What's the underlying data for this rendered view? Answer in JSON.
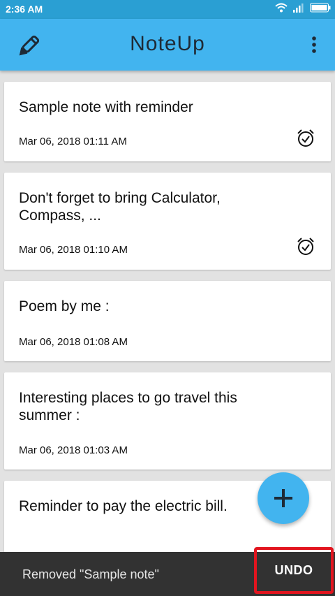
{
  "status_bar": {
    "time": "2:36 AM"
  },
  "app_bar": {
    "title": "NoteUp"
  },
  "notes": [
    {
      "title": "Sample note with reminder",
      "date": "Mar 06, 2018  01:11 AM",
      "has_reminder": true
    },
    {
      "title": "Don't forget to bring Calculator, Compass, ...",
      "date": "Mar 06, 2018  01:10 AM",
      "has_reminder": true
    },
    {
      "title": "Poem by me :",
      "date": "Mar 06, 2018  01:08 AM",
      "has_reminder": false
    },
    {
      "title": "Interesting places to go travel this summer :",
      "date": "Mar 06, 2018  01:03 AM",
      "has_reminder": false
    },
    {
      "title": "Reminder to pay the electric bill.",
      "date": "",
      "has_reminder": false
    }
  ],
  "snackbar": {
    "message": "Removed  \"Sample note\"",
    "action": "UNDO"
  },
  "colors": {
    "primary": "#42b4ef",
    "status_bar": "#2a9fd3",
    "snackbar": "#323232",
    "highlight": "#e2151f"
  }
}
